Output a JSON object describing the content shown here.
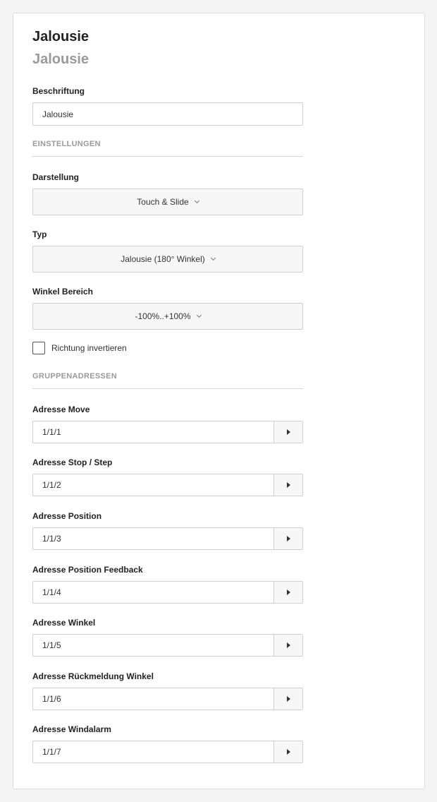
{
  "header": {
    "title": "Jalousie",
    "subtitle": "Jalousie"
  },
  "caption": {
    "label": "Beschriftung",
    "value": "Jalousie"
  },
  "settings": {
    "section_title": "EINSTELLUNGEN",
    "display": {
      "label": "Darstellung",
      "value": "Touch & Slide",
      "icon": "chevron-down-icon"
    },
    "type": {
      "label": "Typ",
      "value": "Jalousie (180° Winkel)",
      "icon": "chevron-down-icon"
    },
    "angle_range": {
      "label": "Winkel Bereich",
      "value": "-100%..+100%",
      "icon": "chevron-down-icon"
    },
    "invert_direction": {
      "label": "Richtung invertieren",
      "checked": false
    }
  },
  "group_addresses": {
    "section_title": "GRUPPENADRESSEN",
    "items": [
      {
        "label": "Adresse Move",
        "value": "1/1/1"
      },
      {
        "label": "Adresse Stop / Step",
        "value": "1/1/2"
      },
      {
        "label": "Adresse Position",
        "value": "1/1/3"
      },
      {
        "label": "Adresse Position Feedback",
        "value": "1/1/4"
      },
      {
        "label": "Adresse Winkel",
        "value": "1/1/5"
      },
      {
        "label": "Adresse Rückmeldung Winkel",
        "value": "1/1/6"
      },
      {
        "label": "Adresse Windalarm",
        "value": "1/1/7"
      }
    ],
    "button_icon": "play-arrow-icon"
  }
}
